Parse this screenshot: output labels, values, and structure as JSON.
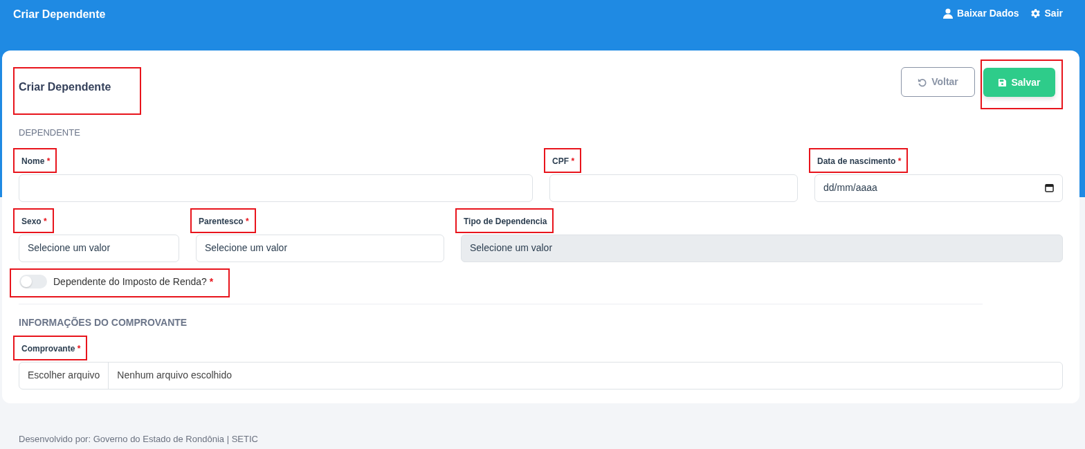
{
  "navbar": {
    "title": "Criar Dependente",
    "links": [
      {
        "label": "Baixar Dados"
      },
      {
        "label": "Sair"
      }
    ]
  },
  "page": {
    "title": "Criar Dependente",
    "highlighted": true
  },
  "actions": [
    {
      "kind": "outline",
      "label": "Voltar",
      "highlighted": false
    },
    {
      "kind": "primary",
      "label": "Salvar",
      "highlighted": true
    }
  ],
  "sections": [
    {
      "title": "DEPENDENTE",
      "rows": [
        [
          {
            "kind": "text",
            "label": "Nome",
            "required_mark": "*",
            "highlighted": true
          },
          {
            "kind": "text",
            "label": "CPF",
            "required_mark": "*",
            "highlighted": true
          },
          {
            "kind": "date",
            "label": "Data de nascimento",
            "required_mark": "*",
            "placeholder": "dd/mm/aaaa",
            "highlighted": true
          }
        ],
        [
          {
            "kind": "select",
            "label": "Sexo",
            "required_mark": "*",
            "placeholder": "Selecione um valor",
            "disabled": false,
            "highlighted": true
          },
          {
            "kind": "select",
            "label": "Parentesco",
            "required_mark": "*",
            "placeholder": "Selecione um valor",
            "disabled": false,
            "highlighted": true
          },
          {
            "kind": "select",
            "label": "Tipo de Dependencia",
            "placeholder": "Selecione um valor",
            "disabled": true,
            "highlighted": true
          }
        ],
        [
          {
            "kind": "switch",
            "label": "Dependente do Imposto de Renda?",
            "required_mark": "*",
            "checked": false,
            "highlighted": true
          }
        ]
      ]
    },
    {
      "title": "INFORMAÇÕES DO COMPROVANTE",
      "rows": [
        [
          {
            "kind": "file",
            "label": "Comprovante",
            "required_mark": "*",
            "button": "Escolher arquivo",
            "value": "Nenhum arquivo escolhido",
            "highlighted": true
          }
        ]
      ]
    }
  ],
  "footer": "Desenvolvido por: Governo do Estado de Rondônia | SETIC"
}
